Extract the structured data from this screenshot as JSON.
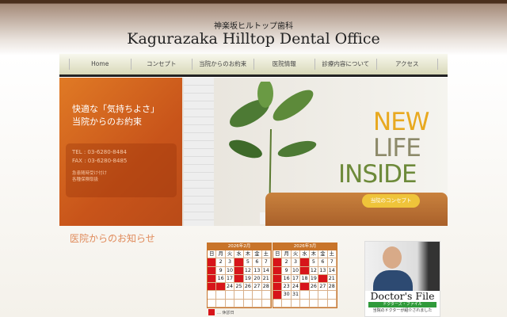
{
  "header": {
    "jp_name": "神楽坂ヒルトップ歯科",
    "en_name": "Kagurazaka Hilltop Dental Office"
  },
  "nav": [
    {
      "label": "Home"
    },
    {
      "label": "コンセプト"
    },
    {
      "label": "当院からのお約束"
    },
    {
      "label": "医院情報"
    },
    {
      "label": "診療内容について"
    },
    {
      "label": "アクセス"
    }
  ],
  "hero": {
    "catch1": "快適な「気持ちよさ」",
    "catch2": "当院からのお約束",
    "tel": "TEL : 03-6280-8484",
    "fax": "FAX : 03-6280-8485",
    "note1": "急患随時受け付け",
    "note2": "各種保険取扱",
    "headline": [
      "NEW",
      "LIFE",
      "INSIDE"
    ],
    "button": "当院のコンセプト"
  },
  "news": {
    "title": "医院からのお知らせ"
  },
  "calendars": [
    {
      "title": "2026年2月",
      "weekdays": [
        "日",
        "月",
        "火",
        "水",
        "木",
        "金",
        "土"
      ],
      "start": 0,
      "days": 28,
      "off": [
        1,
        4,
        8,
        11,
        15,
        18,
        22,
        23
      ]
    },
    {
      "title": "2026年3月",
      "weekdays": [
        "日",
        "月",
        "火",
        "水",
        "木",
        "金",
        "土"
      ],
      "start": 0,
      "days": 31,
      "off": [
        1,
        4,
        8,
        11,
        15,
        20,
        22,
        25,
        29
      ]
    }
  ],
  "legend": "… 休診日",
  "doctors_file": {
    "title": "Doctor's File",
    "kana": "ドクターズ・ファイル",
    "sub": "当院のドクターが紹介されました"
  },
  "colors": {
    "accent": "#c8742a",
    "closed": "#d7151a",
    "orange": "#e07a25"
  }
}
